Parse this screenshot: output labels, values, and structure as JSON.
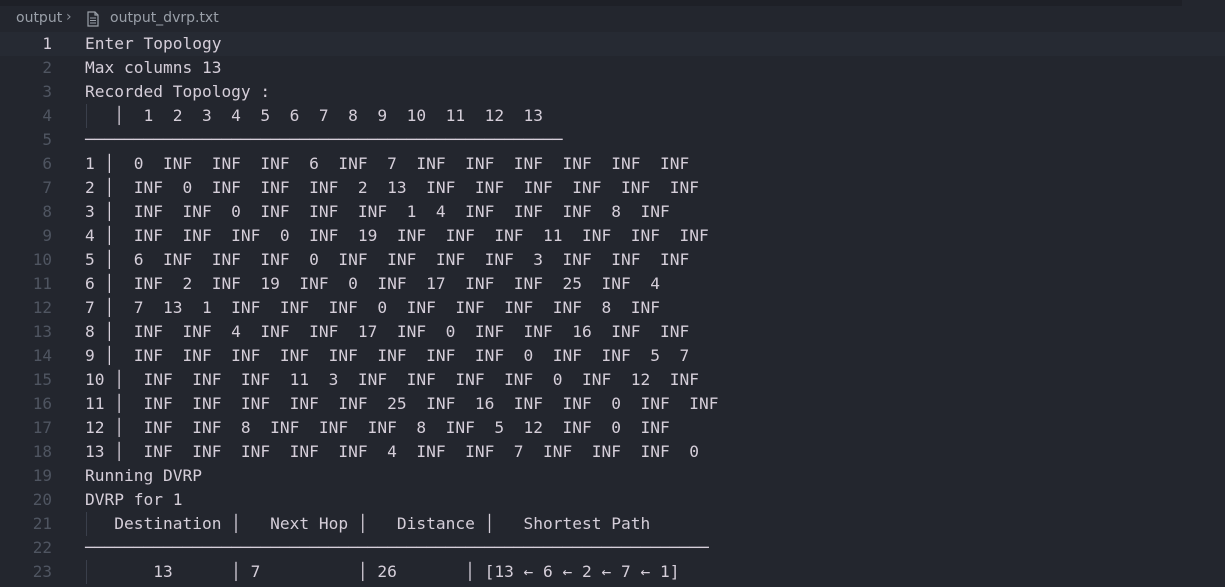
{
  "breadcrumb": {
    "folder": "output",
    "separator": "›",
    "file": "output_dvrp.txt",
    "file_icon": "file-text-icon"
  },
  "editor": {
    "current_line": 1,
    "lines": [
      {
        "n": "1",
        "text": "Enter Topology"
      },
      {
        "n": "2",
        "text": "Max columns 13"
      },
      {
        "n": "3",
        "text": "Recorded Topology :"
      },
      {
        "n": "4",
        "text": "   │  1  2  3  4  5  6  7  8  9  10  11  12  13"
      },
      {
        "n": "5",
        "text": "─────────────────────────────────────────────────"
      },
      {
        "n": "6",
        "text": "1 │  0  INF  INF  INF  6  INF  7  INF  INF  INF  INF  INF  INF"
      },
      {
        "n": "7",
        "text": "2 │  INF  0  INF  INF  INF  2  13  INF  INF  INF  INF  INF  INF"
      },
      {
        "n": "8",
        "text": "3 │  INF  INF  0  INF  INF  INF  1  4  INF  INF  INF  8  INF"
      },
      {
        "n": "9",
        "text": "4 │  INF  INF  INF  0  INF  19  INF  INF  INF  11  INF  INF  INF"
      },
      {
        "n": "10",
        "text": "5 │  6  INF  INF  INF  0  INF  INF  INF  INF  3  INF  INF  INF"
      },
      {
        "n": "11",
        "text": "6 │  INF  2  INF  19  INF  0  INF  17  INF  INF  25  INF  4"
      },
      {
        "n": "12",
        "text": "7 │  7  13  1  INF  INF  INF  0  INF  INF  INF  INF  8  INF"
      },
      {
        "n": "13",
        "text": "8 │  INF  INF  4  INF  INF  17  INF  0  INF  INF  16  INF  INF"
      },
      {
        "n": "14",
        "text": "9 │  INF  INF  INF  INF  INF  INF  INF  INF  0  INF  INF  5  7"
      },
      {
        "n": "15",
        "text": "10 │  INF  INF  INF  11  3  INF  INF  INF  INF  0  INF  12  INF"
      },
      {
        "n": "16",
        "text": "11 │  INF  INF  INF  INF  INF  25  INF  16  INF  INF  0  INF  INF"
      },
      {
        "n": "17",
        "text": "12 │  INF  INF  8  INF  INF  INF  8  INF  5  12  INF  0  INF"
      },
      {
        "n": "18",
        "text": "13 │  INF  INF  INF  INF  INF  4  INF  INF  7  INF  INF  INF  0"
      },
      {
        "n": "19",
        "text": "Running DVRP"
      },
      {
        "n": "20",
        "text": "DVRP for 1"
      },
      {
        "n": "21",
        "text": "   Destination │   Next Hop │   Distance │   Shortest Path"
      },
      {
        "n": "22",
        "text": "────────────────────────────────────────────────────────────────"
      },
      {
        "n": "23",
        "text": "       13      │ 7          │ 26       │ [13 ← 6 ← 2 ← 7 ← 1]"
      }
    ]
  },
  "colors": {
    "background": "#23262e",
    "text": "#d5ced9",
    "line_number": "#4f5561",
    "current_line_bg": "#262a33"
  }
}
